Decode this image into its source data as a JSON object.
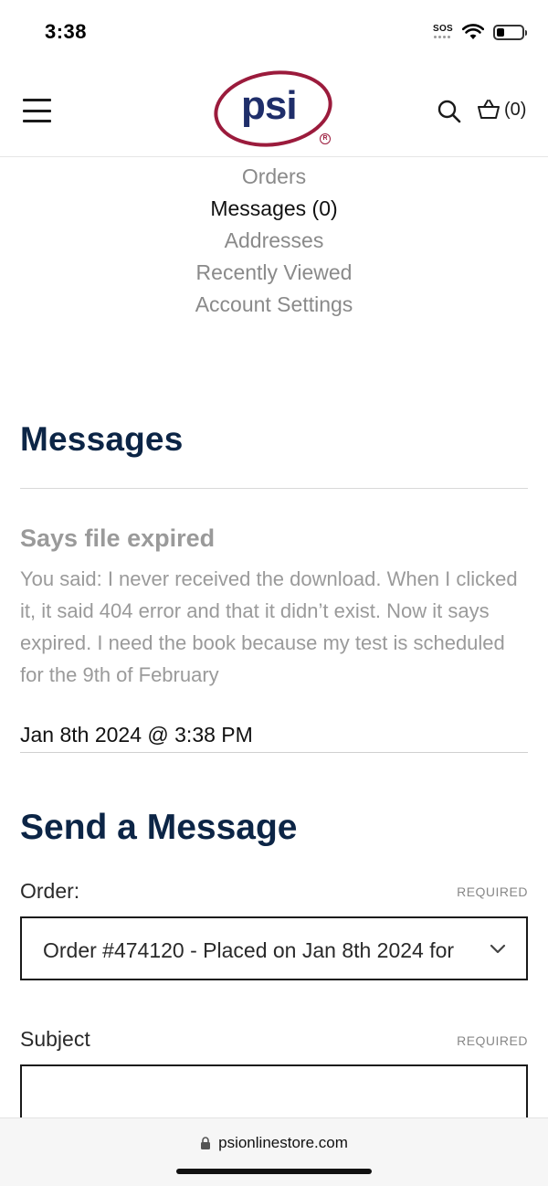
{
  "status_bar": {
    "time": "3:38",
    "sos": "SOS",
    "battery_level": 0.3
  },
  "header": {
    "logo_text": "psi",
    "cart_count": "(0)"
  },
  "account_nav": [
    {
      "label": "Orders",
      "active": false
    },
    {
      "label": "Messages (0)",
      "active": true
    },
    {
      "label": "Addresses",
      "active": false
    },
    {
      "label": "Recently Viewed",
      "active": false
    },
    {
      "label": "Account Settings",
      "active": false
    }
  ],
  "messages": {
    "title": "Messages",
    "items": [
      {
        "subject": "Says file expired",
        "body": "You said: I never received the download. When I clicked it, it said 404 error and that it didn’t exist. Now it says expired. I need the book because my test is scheduled for the 9th of February",
        "date": "Jan 8th 2024 @ 3:38 PM"
      }
    ]
  },
  "send_message": {
    "title": "Send a Message",
    "order_label": "Order:",
    "order_required": "REQUIRED",
    "order_value": "Order #474120 - Placed on Jan 8th 2024 for",
    "subject_label": "Subject",
    "subject_required": "REQUIRED",
    "subject_value": ""
  },
  "browser": {
    "url": "psionlinestore.com"
  },
  "colors": {
    "heading": "#0c2546",
    "logo_ring": "#9b1b3c",
    "logo_text": "#1f2e6a",
    "muted": "#9a9a9a"
  }
}
